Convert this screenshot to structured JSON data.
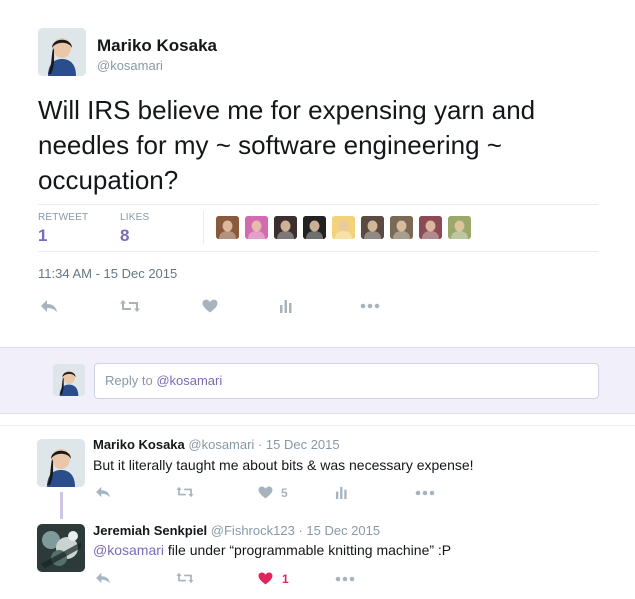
{
  "tweet": {
    "author_name": "Mariko Kosaka",
    "author_handle": "@kosamari",
    "text": "Will IRS believe me for expensing yarn and needles for my ~ software engineering ~ occupation?",
    "retweets_label": "RETWEET",
    "retweets_count": "1",
    "likes_label": "LIKES",
    "likes_count": "8",
    "timestamp": "11:34 AM - 15 Dec 2015",
    "actions": [
      "reply-icon",
      "retweet-icon",
      "heart-icon",
      "analytics-icon",
      "more-icon"
    ]
  },
  "likers": [
    {
      "name": "liker-1",
      "color": "#8a5a3c"
    },
    {
      "name": "liker-2",
      "color": "#d46ab0"
    },
    {
      "name": "liker-3",
      "color": "#3b2f2f"
    },
    {
      "name": "liker-4",
      "color": "#222222"
    },
    {
      "name": "liker-5",
      "color": "#f2d27a"
    },
    {
      "name": "liker-6",
      "color": "#5a4a42"
    },
    {
      "name": "liker-7",
      "color": "#7a6a55"
    },
    {
      "name": "liker-8",
      "color": "#8b4a55"
    },
    {
      "name": "liker-9",
      "color": "#9aa86a"
    }
  ],
  "reply_box": {
    "prefix": "Reply to ",
    "mention": "@kosamari"
  },
  "replies": [
    {
      "author_name": "Mariko Kosaka",
      "author_handle": "@kosamari",
      "date": "· 15 Dec 2015",
      "text": "But it literally taught me about bits & was necessary expense!",
      "like_count": "5"
    },
    {
      "author_name": "Jeremiah Senkpiel",
      "author_handle": "@Fishrock123",
      "date": "· 15 Dec 2015",
      "mention": "@kosamari",
      "text": " file under “programmable knitting machine” :P",
      "like_count": "1"
    }
  ],
  "colors": {
    "accent": "#7b6bb8",
    "liked": "#e0245e",
    "muted": "#8899a6",
    "reply_bg": "#f1eff9"
  }
}
